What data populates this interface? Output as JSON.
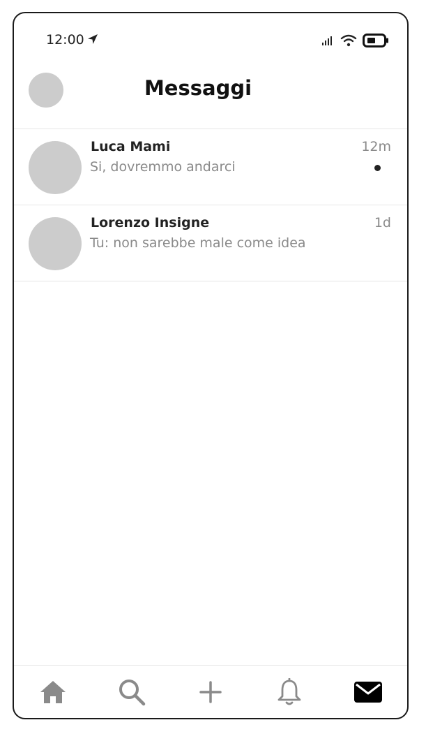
{
  "status_bar": {
    "time": "12:00",
    "icons": [
      "location-arrow-icon",
      "signal-icon",
      "wifi-icon",
      "battery-icon"
    ]
  },
  "header": {
    "title": "Messaggi"
  },
  "messages": [
    {
      "name": "Luca Mami",
      "preview": "Si, dovremmo andarci",
      "time": "12m",
      "unread": true
    },
    {
      "name": "Lorenzo Insigne",
      "preview": "Tu: non sarebbe male come idea",
      "time": "1d",
      "unread": false
    }
  ],
  "tab_bar": {
    "tabs": [
      {
        "icon": "home-icon",
        "active": false
      },
      {
        "icon": "search-icon",
        "active": false
      },
      {
        "icon": "plus-icon",
        "active": false
      },
      {
        "icon": "bell-icon",
        "active": false
      },
      {
        "icon": "mail-icon",
        "active": true
      }
    ]
  },
  "colors": {
    "avatar": "#cccccc",
    "secondary_text": "#8a8a8a",
    "inactive_icon": "#8a8a8a",
    "active_icon": "#000000",
    "divider": "#e6e6e6"
  }
}
